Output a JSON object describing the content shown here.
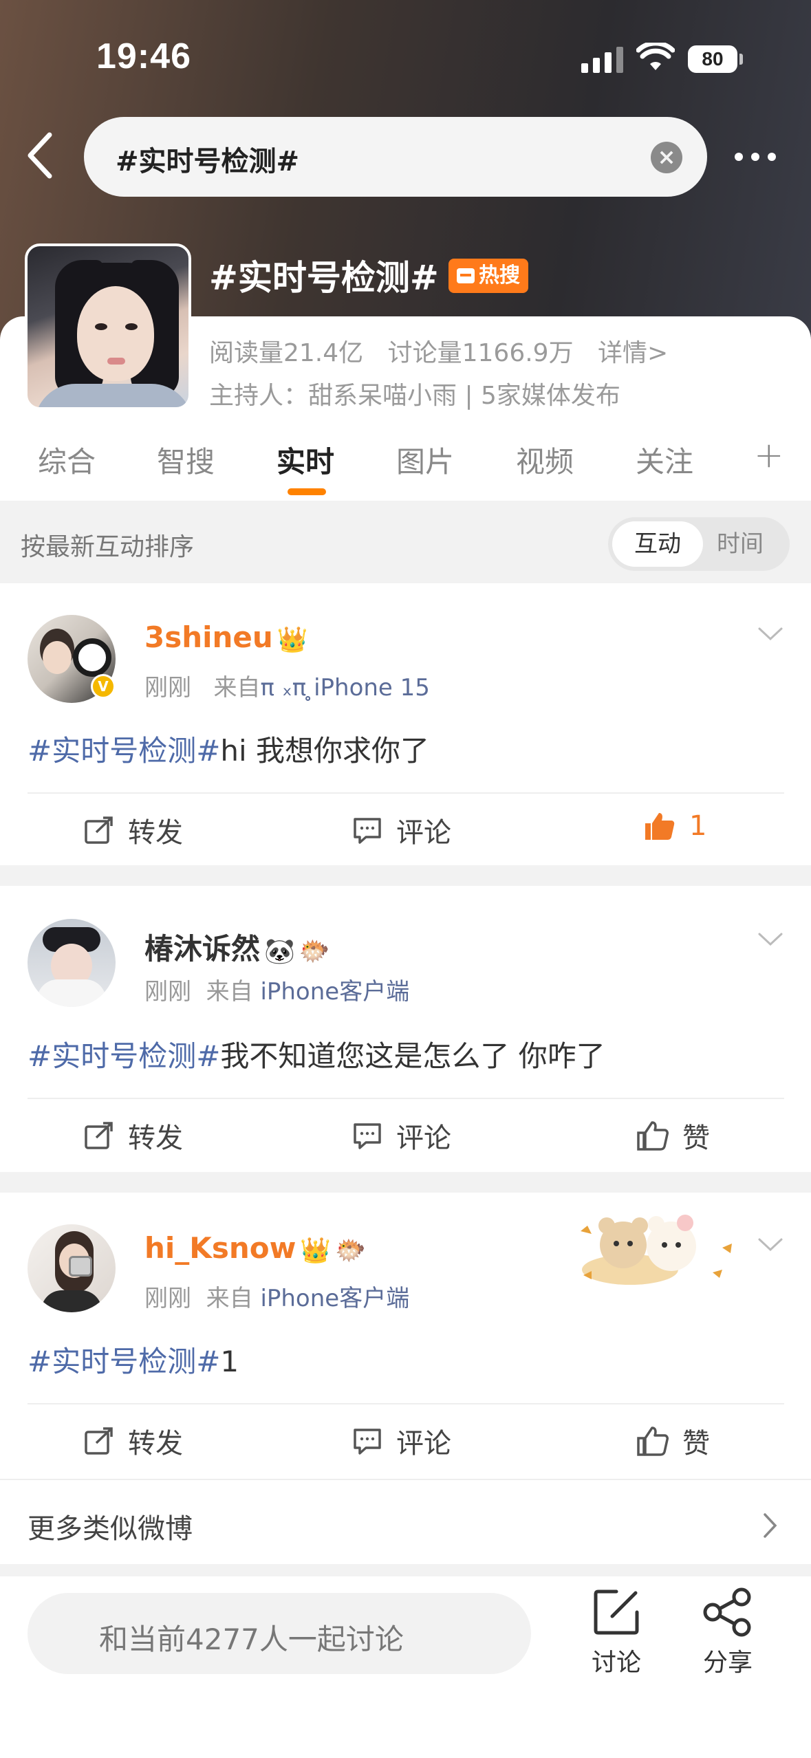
{
  "status_bar": {
    "time": "19:46",
    "battery": "80"
  },
  "search": {
    "query": "#实时号检测#"
  },
  "topic": {
    "title": "#实时号检测#",
    "badge": "热搜",
    "reads": "阅读量21.4亿",
    "discussions": "讨论量1166.9万",
    "details": "详情>",
    "host": "主持人：甜系呆喵小雨 | 5家媒体发布"
  },
  "tabs": [
    {
      "label": "综合"
    },
    {
      "label": "智搜"
    },
    {
      "label": "实时"
    },
    {
      "label": "图片"
    },
    {
      "label": "视频"
    },
    {
      "label": "关注"
    }
  ],
  "active_tab": "实时",
  "sort": {
    "label": "按最新互动排序",
    "options": [
      "互动",
      "时间"
    ],
    "selected": "互动"
  },
  "posts": [
    {
      "username": "3shineu",
      "time": "刚刚",
      "source_prefix": "来自",
      "source": "π ₓπ ̥iPhone 15",
      "hashtag": "#实时号检测#",
      "text": "hi 我想你求你了",
      "repost_label": "转发",
      "comment_label": "评论",
      "like_label": "1",
      "liked": true
    },
    {
      "username": "椿沐诉然",
      "time": "刚刚",
      "source_prefix": "来自",
      "source": "iPhone客户端",
      "hashtag": "#实时号检测#",
      "text": "我不知道您这是怎么了 你咋了",
      "repost_label": "转发",
      "comment_label": "评论",
      "like_label": "赞",
      "liked": false
    },
    {
      "username": "hi_Ksnow",
      "time": "刚刚",
      "source_prefix": "来自",
      "source": "iPhone客户端",
      "hashtag": "#实时号检测#",
      "text": "1",
      "repost_label": "转发",
      "comment_label": "评论",
      "like_label": "赞",
      "liked": false
    }
  ],
  "more_similar": "更多类似微博",
  "bottom": {
    "input_placeholder": "和当前4277人一起讨论",
    "discuss_label": "讨论",
    "share_label": "分享"
  },
  "colors": {
    "accent": "#ff8200",
    "hashtag": "#4e6aa8",
    "username_vip": "#f27a26",
    "hot_badge": "#ff7a1a"
  }
}
